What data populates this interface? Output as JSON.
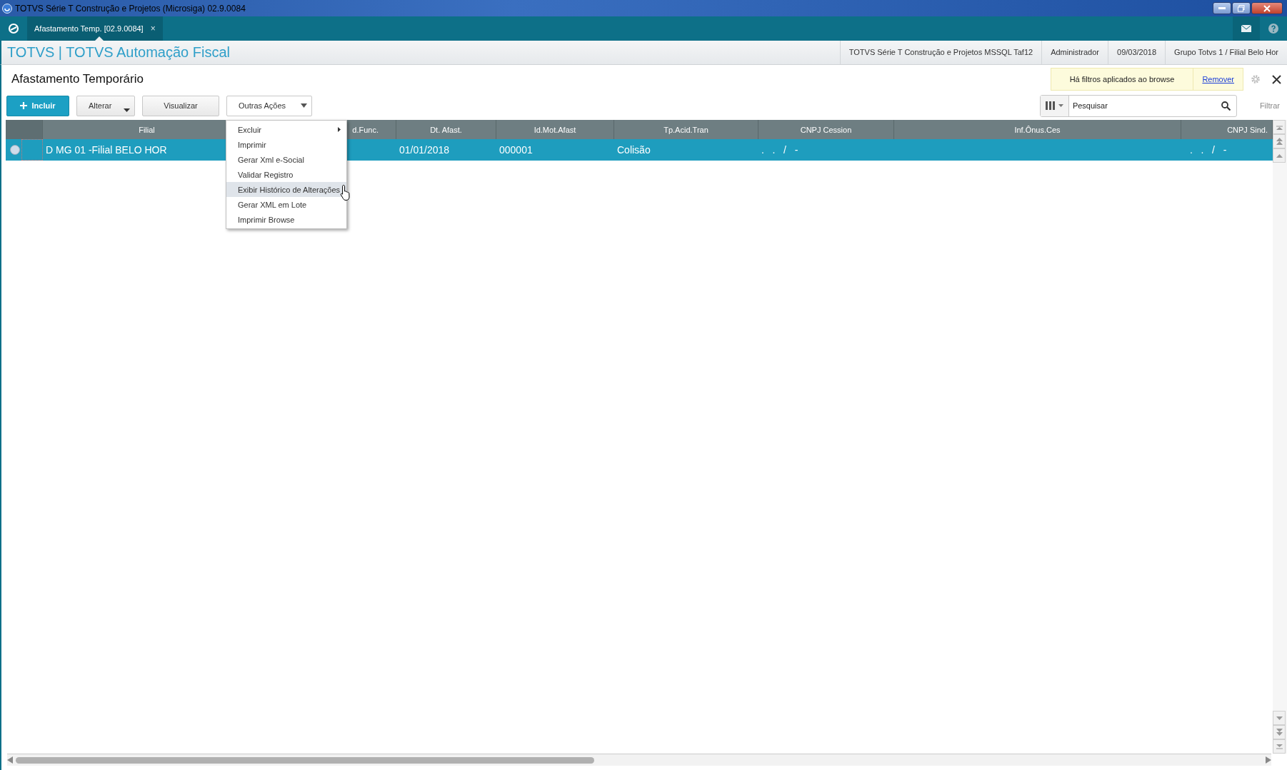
{
  "window": {
    "title": "TOTVS Série T Construção e Projetos (Microsiga) 02.9.0084"
  },
  "tabs": [
    {
      "label": "Afastamento Temp. [02.9.0084]",
      "selected": true,
      "close_label": "×"
    }
  ],
  "header": {
    "app_title": "TOTVS | TOTVS Automação Fiscal",
    "info": [
      "TOTVS Série T Construção e Projetos MSSQL Taf12",
      "Administrador",
      "09/03/2018",
      "Grupo Totvs 1 / Filial Belo Hor"
    ]
  },
  "page": {
    "title": "Afastamento Temporário",
    "filter_notice": "Há filtros aplicados ao browse",
    "filter_link": "Remover"
  },
  "toolbar": [
    {
      "label": "Incluir",
      "kind": "primary"
    },
    {
      "label": "Alterar",
      "kind": "split"
    },
    {
      "label": "Visualizar",
      "kind": "plain"
    },
    {
      "label": "Outras Ações",
      "kind": "dropdown"
    }
  ],
  "search": {
    "placeholder": "Pesquisar",
    "filter_label": "Filtrar"
  },
  "table": {
    "columns": [
      "Filial",
      "d.Func.",
      "Dt. Afast.",
      "Id.Mot.Afast",
      "Tp.Acid.Tran",
      "CNPJ Cession",
      "Inf.Ônus.Ces",
      "CNPJ Sind."
    ],
    "rows": [
      {
        "selected": true,
        "cells": [
          "D MG 01 -Filial BELO HOR",
          null,
          "01/01/2018",
          "000001",
          "Colisão",
          ".   .   /   -",
          null,
          ".   .   /   -"
        ]
      }
    ]
  },
  "menu": [
    {
      "label": "Excluir",
      "has_submenu": true,
      "selected": false
    },
    {
      "label": "Imprimir",
      "has_submenu": false,
      "selected": false
    },
    {
      "label": "Gerar Xml e-Social",
      "has_submenu": false,
      "selected": false
    },
    {
      "label": "Validar Registro",
      "has_submenu": false,
      "selected": false
    },
    {
      "label": "Exibir Histórico de Alterações",
      "has_submenu": false,
      "selected": true
    },
    {
      "label": "Gerar XML em Lote",
      "has_submenu": false,
      "selected": false
    },
    {
      "label": "Imprimir Browse",
      "has_submenu": false,
      "selected": false
    }
  ]
}
